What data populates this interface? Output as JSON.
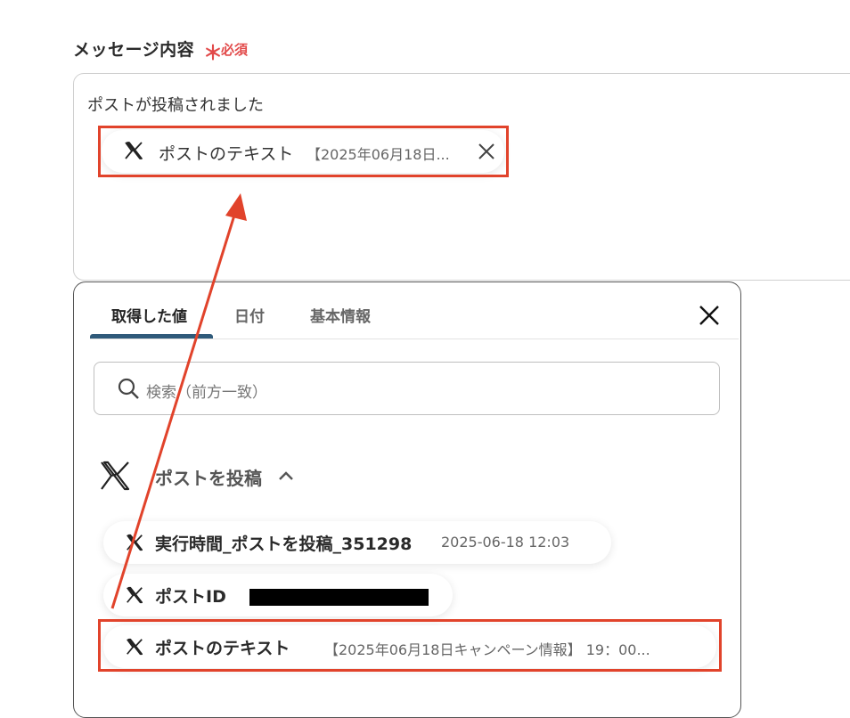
{
  "field": {
    "label": "メッセージ内容",
    "required_mark": "＊",
    "required_text": "必須",
    "message_text": "ポストが投稿されました",
    "chip": {
      "icon": "x-logo-icon",
      "label": "ポストのテキスト",
      "value": "【2025年06月18日..."
    }
  },
  "panel": {
    "tabs": [
      {
        "label": "取得した値",
        "active": true
      },
      {
        "label": "日付",
        "active": false
      },
      {
        "label": "基本情報",
        "active": false
      }
    ],
    "search": {
      "placeholder": "検索（前方一致）"
    },
    "group": {
      "icon": "x-logo-icon",
      "title": "ポストを投稿"
    },
    "items": [
      {
        "label": "実行時間_ポストを投稿_351298",
        "value": "2025-06-18 12:03"
      },
      {
        "label": "ポストID",
        "value": ""
      },
      {
        "label": "ポストのテキスト",
        "value": "【2025年06月18日キャンペーン情報】 19：00..."
      }
    ]
  },
  "colors": {
    "accent": "#2f5a7a",
    "required": "#e24a4a",
    "highlight": "#e1432b"
  }
}
